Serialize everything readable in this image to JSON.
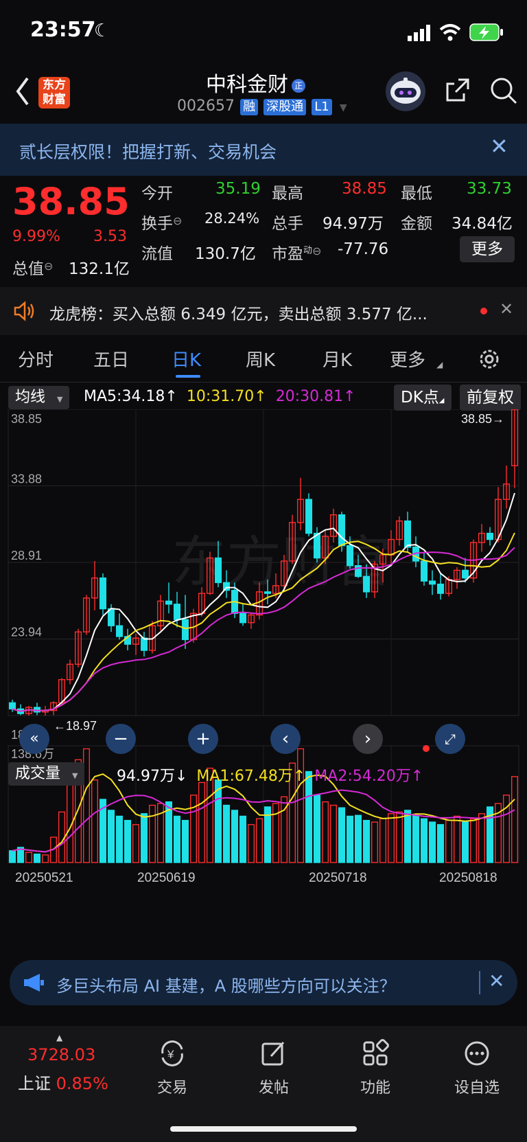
{
  "status_bar": {
    "time": "23:57"
  },
  "header": {
    "back_label": "‹",
    "logo_line1": "东方",
    "logo_line2": "财富",
    "stock_name": "中科金财",
    "stock_code": "002657",
    "badges": [
      "融",
      "深股通",
      "L1"
    ]
  },
  "banner": {
    "text": "贰长层权限！把握打新、交易机会"
  },
  "quote": {
    "price": "38.85",
    "change_pct": "9.99%",
    "change": "3.53",
    "open_label": "今开",
    "open": "35.19",
    "high_label": "最高",
    "high": "38.85",
    "low_label": "最低",
    "low": "33.73",
    "turnover_label": "换手",
    "turnover": "28.24%",
    "volume_label": "总手",
    "volume": "94.97万",
    "amount_label": "金额",
    "amount": "34.84亿",
    "mktcap_label": "总值",
    "mktcap": "132.1亿",
    "float_label": "流值",
    "float": "130.7亿",
    "pe_label": "市盈",
    "pe_sup": "动",
    "pe": "-77.76",
    "more_label": "更多"
  },
  "lhb": {
    "label": "龙虎榜：",
    "text": "买入总额 6.349 亿元，卖出总额 3.577 亿..."
  },
  "tabs": [
    {
      "label": "分时"
    },
    {
      "label": "五日"
    },
    {
      "label": "日K"
    },
    {
      "label": "周K"
    },
    {
      "label": "月K"
    },
    {
      "label": "更多"
    }
  ],
  "active_tab": 2,
  "chart_header": {
    "selector": "均线",
    "ma5": "MA5:34.18",
    "ma10": "10:31.70",
    "ma20": "20:30.81",
    "dk_label": "DK点",
    "adjust_label": "前复权"
  },
  "price_axis_labels": [
    "38.85",
    "33.88",
    "28.91",
    "23.94",
    "18.97"
  ],
  "max_annotation": "38.85",
  "min_annotation": "18.97",
  "volume_header": {
    "selector": "成交量",
    "vol": "94.97万",
    "ma1": "MA1:67.48万",
    "ma2": "MA2:54.20万",
    "axis_top": "138.6万"
  },
  "date_labels": [
    "20250521",
    "20250619",
    "20250718",
    "20250818"
  ],
  "news": {
    "text": "多巨头布局 AI 基建，A 股哪些方向可以关注？"
  },
  "bottom_nav": {
    "index_value": "3728.03",
    "index_name": "上证",
    "index_change": "0.85%",
    "items": [
      {
        "label": "交易"
      },
      {
        "label": "发帖"
      },
      {
        "label": "功能"
      },
      {
        "label": "设自选"
      }
    ]
  },
  "colors": {
    "up": "#ff2d2d",
    "down": "#1ee0e6",
    "ma5": "#ffffff",
    "ma10": "#f5e020",
    "ma20": "#d62ad6"
  },
  "chart_data": {
    "type": "candlestick",
    "price_range": [
      18.97,
      38.85
    ],
    "candles_ohlc": [
      [
        19.8,
        20.0,
        19.2,
        19.4
      ],
      [
        19.4,
        19.7,
        19.0,
        19.1
      ],
      [
        19.1,
        19.6,
        18.97,
        19.5
      ],
      [
        19.5,
        19.8,
        19.0,
        19.2
      ],
      [
        19.2,
        19.6,
        18.97,
        19.3
      ],
      [
        19.3,
        19.9,
        19.0,
        19.8
      ],
      [
        19.8,
        21.4,
        19.6,
        21.3
      ],
      [
        21.3,
        22.6,
        21.0,
        22.3
      ],
      [
        22.3,
        24.6,
        22.1,
        24.4
      ],
      [
        24.4,
        26.8,
        24.2,
        26.6
      ],
      [
        26.6,
        29.0,
        25.8,
        27.9
      ],
      [
        27.9,
        28.2,
        25.5,
        25.9
      ],
      [
        25.9,
        26.2,
        24.4,
        24.8
      ],
      [
        24.8,
        25.6,
        23.9,
        24.1
      ],
      [
        24.1,
        24.6,
        23.2,
        23.6
      ],
      [
        23.6,
        24.3,
        22.9,
        24.0
      ],
      [
        24.0,
        24.4,
        22.8,
        23.2
      ],
      [
        23.2,
        25.1,
        23.0,
        24.8
      ],
      [
        24.8,
        26.8,
        24.5,
        26.4
      ],
      [
        26.4,
        27.6,
        25.6,
        26.2
      ],
      [
        26.2,
        27.0,
        24.7,
        25.2
      ],
      [
        25.2,
        26.8,
        23.3,
        23.9
      ],
      [
        23.9,
        25.9,
        23.7,
        25.6
      ],
      [
        25.6,
        27.3,
        25.4,
        26.9
      ],
      [
        26.9,
        29.6,
        26.8,
        29.2
      ],
      [
        29.2,
        30.3,
        27.3,
        27.6
      ],
      [
        27.6,
        28.4,
        26.6,
        27.1
      ],
      [
        27.1,
        27.6,
        25.3,
        25.6
      ],
      [
        25.6,
        26.2,
        24.8,
        25.0
      ],
      [
        25.0,
        25.6,
        24.6,
        25.5
      ],
      [
        25.5,
        27.6,
        25.2,
        27.0
      ],
      [
        27.0,
        27.8,
        26.2,
        26.9
      ],
      [
        26.9,
        28.2,
        26.6,
        27.4
      ],
      [
        27.4,
        29.4,
        27.0,
        29.0
      ],
      [
        29.0,
        32.0,
        28.8,
        31.5
      ],
      [
        31.5,
        34.4,
        31.0,
        33.0
      ],
      [
        33.0,
        33.4,
        30.6,
        30.8
      ],
      [
        30.8,
        31.2,
        28.9,
        29.2
      ],
      [
        29.2,
        31.0,
        28.8,
        30.6
      ],
      [
        30.6,
        32.4,
        30.2,
        32.0
      ],
      [
        32.0,
        32.2,
        29.6,
        30.0
      ],
      [
        30.0,
        30.6,
        28.5,
        28.7
      ],
      [
        28.7,
        29.4,
        27.9,
        28.0
      ],
      [
        28.0,
        28.8,
        26.6,
        27.0
      ],
      [
        27.0,
        29.0,
        26.6,
        28.8
      ],
      [
        28.8,
        29.8,
        27.6,
        29.4
      ],
      [
        29.4,
        31.0,
        28.8,
        30.4
      ],
      [
        30.4,
        31.9,
        30.0,
        31.6
      ],
      [
        31.6,
        32.2,
        29.6,
        29.9
      ],
      [
        29.9,
        30.6,
        28.6,
        29.0
      ],
      [
        29.0,
        29.6,
        27.4,
        27.7
      ],
      [
        27.7,
        28.4,
        26.8,
        27.5
      ],
      [
        27.5,
        28.2,
        26.5,
        26.9
      ],
      [
        26.9,
        28.0,
        26.7,
        27.8
      ],
      [
        27.8,
        28.6,
        27.2,
        28.4
      ],
      [
        28.4,
        29.2,
        27.6,
        27.9
      ],
      [
        27.9,
        30.4,
        27.6,
        30.2
      ],
      [
        30.2,
        31.4,
        29.6,
        30.8
      ],
      [
        30.8,
        31.2,
        30.0,
        30.4
      ],
      [
        30.4,
        33.8,
        30.2,
        33.0
      ],
      [
        33.0,
        35.2,
        32.4,
        34.0
      ],
      [
        35.19,
        38.85,
        33.73,
        38.85
      ]
    ],
    "ma5_last": 34.18,
    "ma10_last": 31.7,
    "ma20_last": 30.81,
    "volume_range": [
      0,
      138.6
    ],
    "volume_unit": "万",
    "volumes": [
      14,
      18,
      12,
      10,
      9,
      30,
      60,
      95,
      122,
      135,
      98,
      75,
      62,
      55,
      50,
      45,
      58,
      68,
      70,
      72,
      55,
      50,
      80,
      95,
      112,
      98,
      68,
      62,
      55,
      45,
      52,
      66,
      70,
      78,
      118,
      135,
      108,
      80,
      72,
      68,
      65,
      55,
      56,
      50,
      48,
      52,
      58,
      60,
      62,
      56,
      52,
      48,
      45,
      50,
      55,
      48,
      52,
      58,
      66,
      70,
      80,
      102
    ]
  }
}
